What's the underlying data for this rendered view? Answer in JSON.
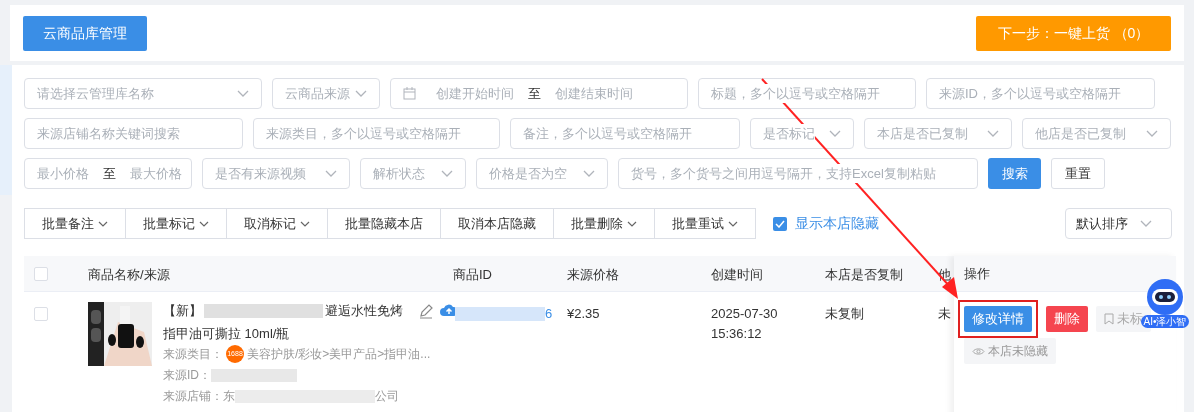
{
  "header": {
    "library_button": "云商品库管理",
    "next_button": "下一步：一键上货 （0）"
  },
  "filters": [
    [
      {
        "kind": "select",
        "placeholder": "请选择云管理库名称"
      },
      {
        "kind": "select",
        "placeholder": "云商品来源"
      },
      {
        "kind": "date_range",
        "start": "创建开始时间",
        "sep": "至",
        "end": "创建结束时间"
      },
      {
        "kind": "input",
        "placeholder": "标题，多个以逗号或空格隔开"
      },
      {
        "kind": "input",
        "placeholder": "来源ID，多个以逗号或空格隔开"
      }
    ],
    [
      {
        "kind": "input",
        "placeholder": "来源店铺名称关键词搜索"
      },
      {
        "kind": "input",
        "placeholder": "来源类目，多个以逗号或空格隔开"
      },
      {
        "kind": "input",
        "placeholder": "备注，多个以逗号或空格隔开"
      },
      {
        "kind": "select",
        "placeholder": "是否标记"
      },
      {
        "kind": "select",
        "placeholder": "本店是否已复制"
      },
      {
        "kind": "select",
        "placeholder": "他店是否已复制"
      }
    ],
    [
      {
        "kind": "range",
        "start": "最小价格",
        "sep": "至",
        "end": "最大价格"
      },
      {
        "kind": "select",
        "placeholder": "是否有来源视频"
      },
      {
        "kind": "select",
        "placeholder": "解析状态"
      },
      {
        "kind": "select",
        "placeholder": "价格是否为空"
      },
      {
        "kind": "input",
        "placeholder": "货号，多个货号之间用逗号隔开，支持Excel复制粘贴"
      },
      {
        "kind": "primary",
        "label": "搜索"
      },
      {
        "kind": "button",
        "label": "重置"
      }
    ]
  ],
  "toolbar": {
    "buttons": [
      {
        "label": "批量备注",
        "dropdown": true
      },
      {
        "label": "批量标记",
        "dropdown": true
      },
      {
        "label": "取消标记",
        "dropdown": true
      },
      {
        "label": "批量隐藏本店",
        "dropdown": false
      },
      {
        "label": "取消本店隐藏",
        "dropdown": false
      },
      {
        "label": "批量删除",
        "dropdown": true
      },
      {
        "label": "批量重试",
        "dropdown": true
      }
    ],
    "show_hidden": {
      "label": "显示本店隐藏",
      "checked": true
    },
    "sort": "默认排序"
  },
  "table": {
    "all_selected": false,
    "columns": [
      "商品名称/来源",
      "商品ID",
      "来源价格",
      "创建时间",
      "本店是否复制",
      "他"
    ],
    "rows": [
      {
        "selected": false,
        "title_start": "【新】",
        "title_end": "避逅水性免烤",
        "title_line2": "指甲油可撕拉 10ml/瓶",
        "product_id": "6",
        "price": "¥2.35",
        "created": "2025-07-30",
        "created_time": "15:36:12",
        "copied": "未复制",
        "other": "未",
        "category_label": "来源类目：",
        "category_badge": "1688",
        "category": "美容护肤/彩妆>美甲产品>指甲油...",
        "source_id_label": "来源ID：",
        "shop_label": "来源店铺：东",
        "shop_end": "公司"
      }
    ]
  },
  "operations": {
    "header": "操作",
    "actions": [
      {
        "kind": "primary",
        "label": "修改详情",
        "highlighted": true
      },
      {
        "kind": "danger",
        "label": "删除"
      },
      {
        "kind": "mark",
        "label": "未标"
      },
      {
        "kind": "hide",
        "label": "本店未隐藏"
      }
    ]
  },
  "assistant": {
    "label": "AI•泽小智"
  }
}
